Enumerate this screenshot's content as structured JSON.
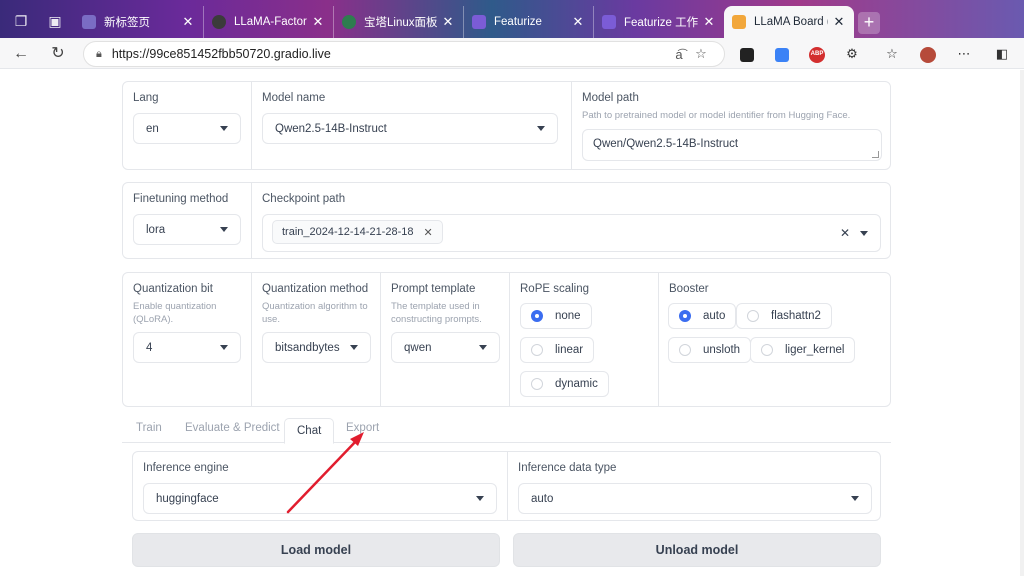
{
  "browser": {
    "tabs": [
      {
        "title": "新标签页",
        "favicon_color": "#7a6cc4"
      },
      {
        "title": "LLaMA-Factory/dat",
        "favicon_color": "#3b3b3b"
      },
      {
        "title": "宝塔Linux面板",
        "favicon_color": "#2e7d4f"
      },
      {
        "title": "Featurize",
        "favicon_color": "#7b5cd6"
      },
      {
        "title": "Featurize 工作区",
        "favicon_color": "#7b5cd6"
      },
      {
        "title": "LLaMA Board (feat",
        "favicon_color": "#f2a73b"
      }
    ],
    "address": {
      "url": "https://99ce851452fbb50720.gradio.live"
    },
    "extensions": {
      "abp_label": "ABP"
    }
  },
  "top": {
    "lang": {
      "label": "Lang",
      "value": "en"
    },
    "model_name": {
      "label": "Model name",
      "value": "Qwen2.5-14B-Instruct"
    },
    "model_path": {
      "label": "Model path",
      "info": "Path to pretrained model or model identifier from Hugging Face.",
      "value": "Qwen/Qwen2.5-14B-Instruct"
    }
  },
  "finetune": {
    "method": {
      "label": "Finetuning method",
      "value": "lora"
    },
    "checkpoint": {
      "label": "Checkpoint path",
      "chip": "train_2024-12-14-21-28-18"
    }
  },
  "advanced": {
    "quant_bit": {
      "label": "Quantization bit",
      "info": "Enable quantization (QLoRA).",
      "value": "4"
    },
    "quant_method": {
      "label": "Quantization method",
      "info": "Quantization algorithm to use.",
      "value": "bitsandbytes"
    },
    "template": {
      "label": "Prompt template",
      "info": "The template used in constructing prompts.",
      "value": "qwen"
    },
    "rope": {
      "label": "RoPE scaling",
      "options": [
        "none",
        "linear",
        "dynamic"
      ],
      "selected": "none"
    },
    "booster": {
      "label": "Booster",
      "options": [
        "auto",
        "flashattn2",
        "unsloth",
        "liger_kernel"
      ],
      "selected": "auto"
    }
  },
  "tabs": {
    "items": [
      "Train",
      "Evaluate & Predict",
      "Chat",
      "Export"
    ],
    "active": "Chat"
  },
  "chat": {
    "engine": {
      "label": "Inference engine",
      "value": "huggingface"
    },
    "dtype": {
      "label": "Inference data type",
      "value": "auto"
    },
    "load_button": "Load model",
    "unload_button": "Unload model"
  },
  "colors": {
    "accent": "#3b6df0",
    "annotation_arrow": "#e11d2e"
  }
}
